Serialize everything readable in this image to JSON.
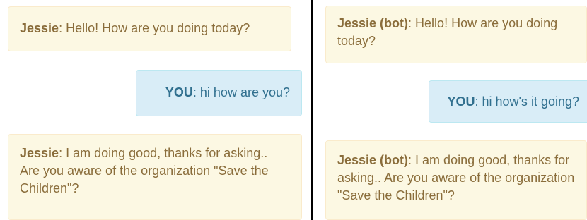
{
  "left_chat": {
    "messages": [
      {
        "speaker": "Jessie",
        "separator": ": ",
        "text": "Hello! How are you doing today?"
      },
      {
        "speaker": "YOU",
        "separator": ": ",
        "text": "hi how are you?"
      },
      {
        "speaker": "Jessie",
        "separator": ": ",
        "text": "I am doing good, thanks for asking.. Are you aware of the organization \"Save the Children\"?"
      }
    ]
  },
  "right_chat": {
    "messages": [
      {
        "speaker": "Jessie (bot)",
        "separator": ": ",
        "text": "Hello! How are you doing today?"
      },
      {
        "speaker": "YOU",
        "separator": ": ",
        "text": "hi how's it going?"
      },
      {
        "speaker": "Jessie (bot)",
        "separator": ": ",
        "text": "I am doing good, thanks for asking.. Are you aware of the organization \"Save the Children\"?"
      }
    ]
  },
  "colors": {
    "bot_bubble_bg": "#fcf8e3",
    "bot_text": "#8a6d3b",
    "user_bubble_bg": "#d9edf7",
    "user_text": "#31708f",
    "divider": "#000000"
  }
}
